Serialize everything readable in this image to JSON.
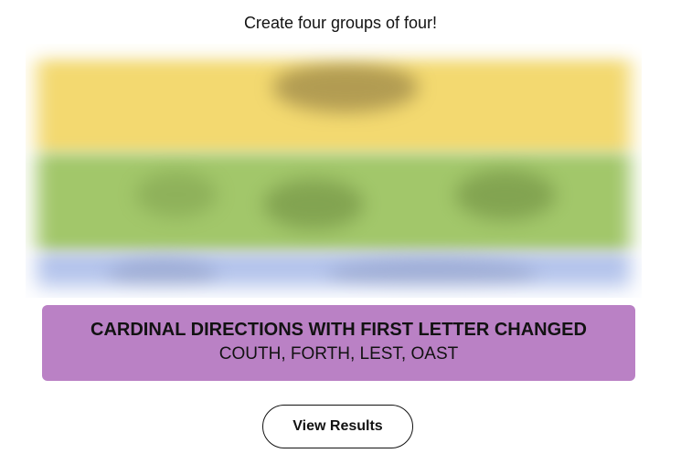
{
  "instructions": "Create four groups of four!",
  "solved_group": {
    "title": "CARDINAL DIRECTIONS WITH FIRST LETTER CHANGED",
    "members": "COUTH, FORTH, LEST, OAST",
    "color": "#ba81c5"
  },
  "hidden_groups_colors": [
    "#f3d970",
    "#a2c76a",
    "#b4c4ec"
  ],
  "actions": {
    "view_results_label": "View Results"
  }
}
